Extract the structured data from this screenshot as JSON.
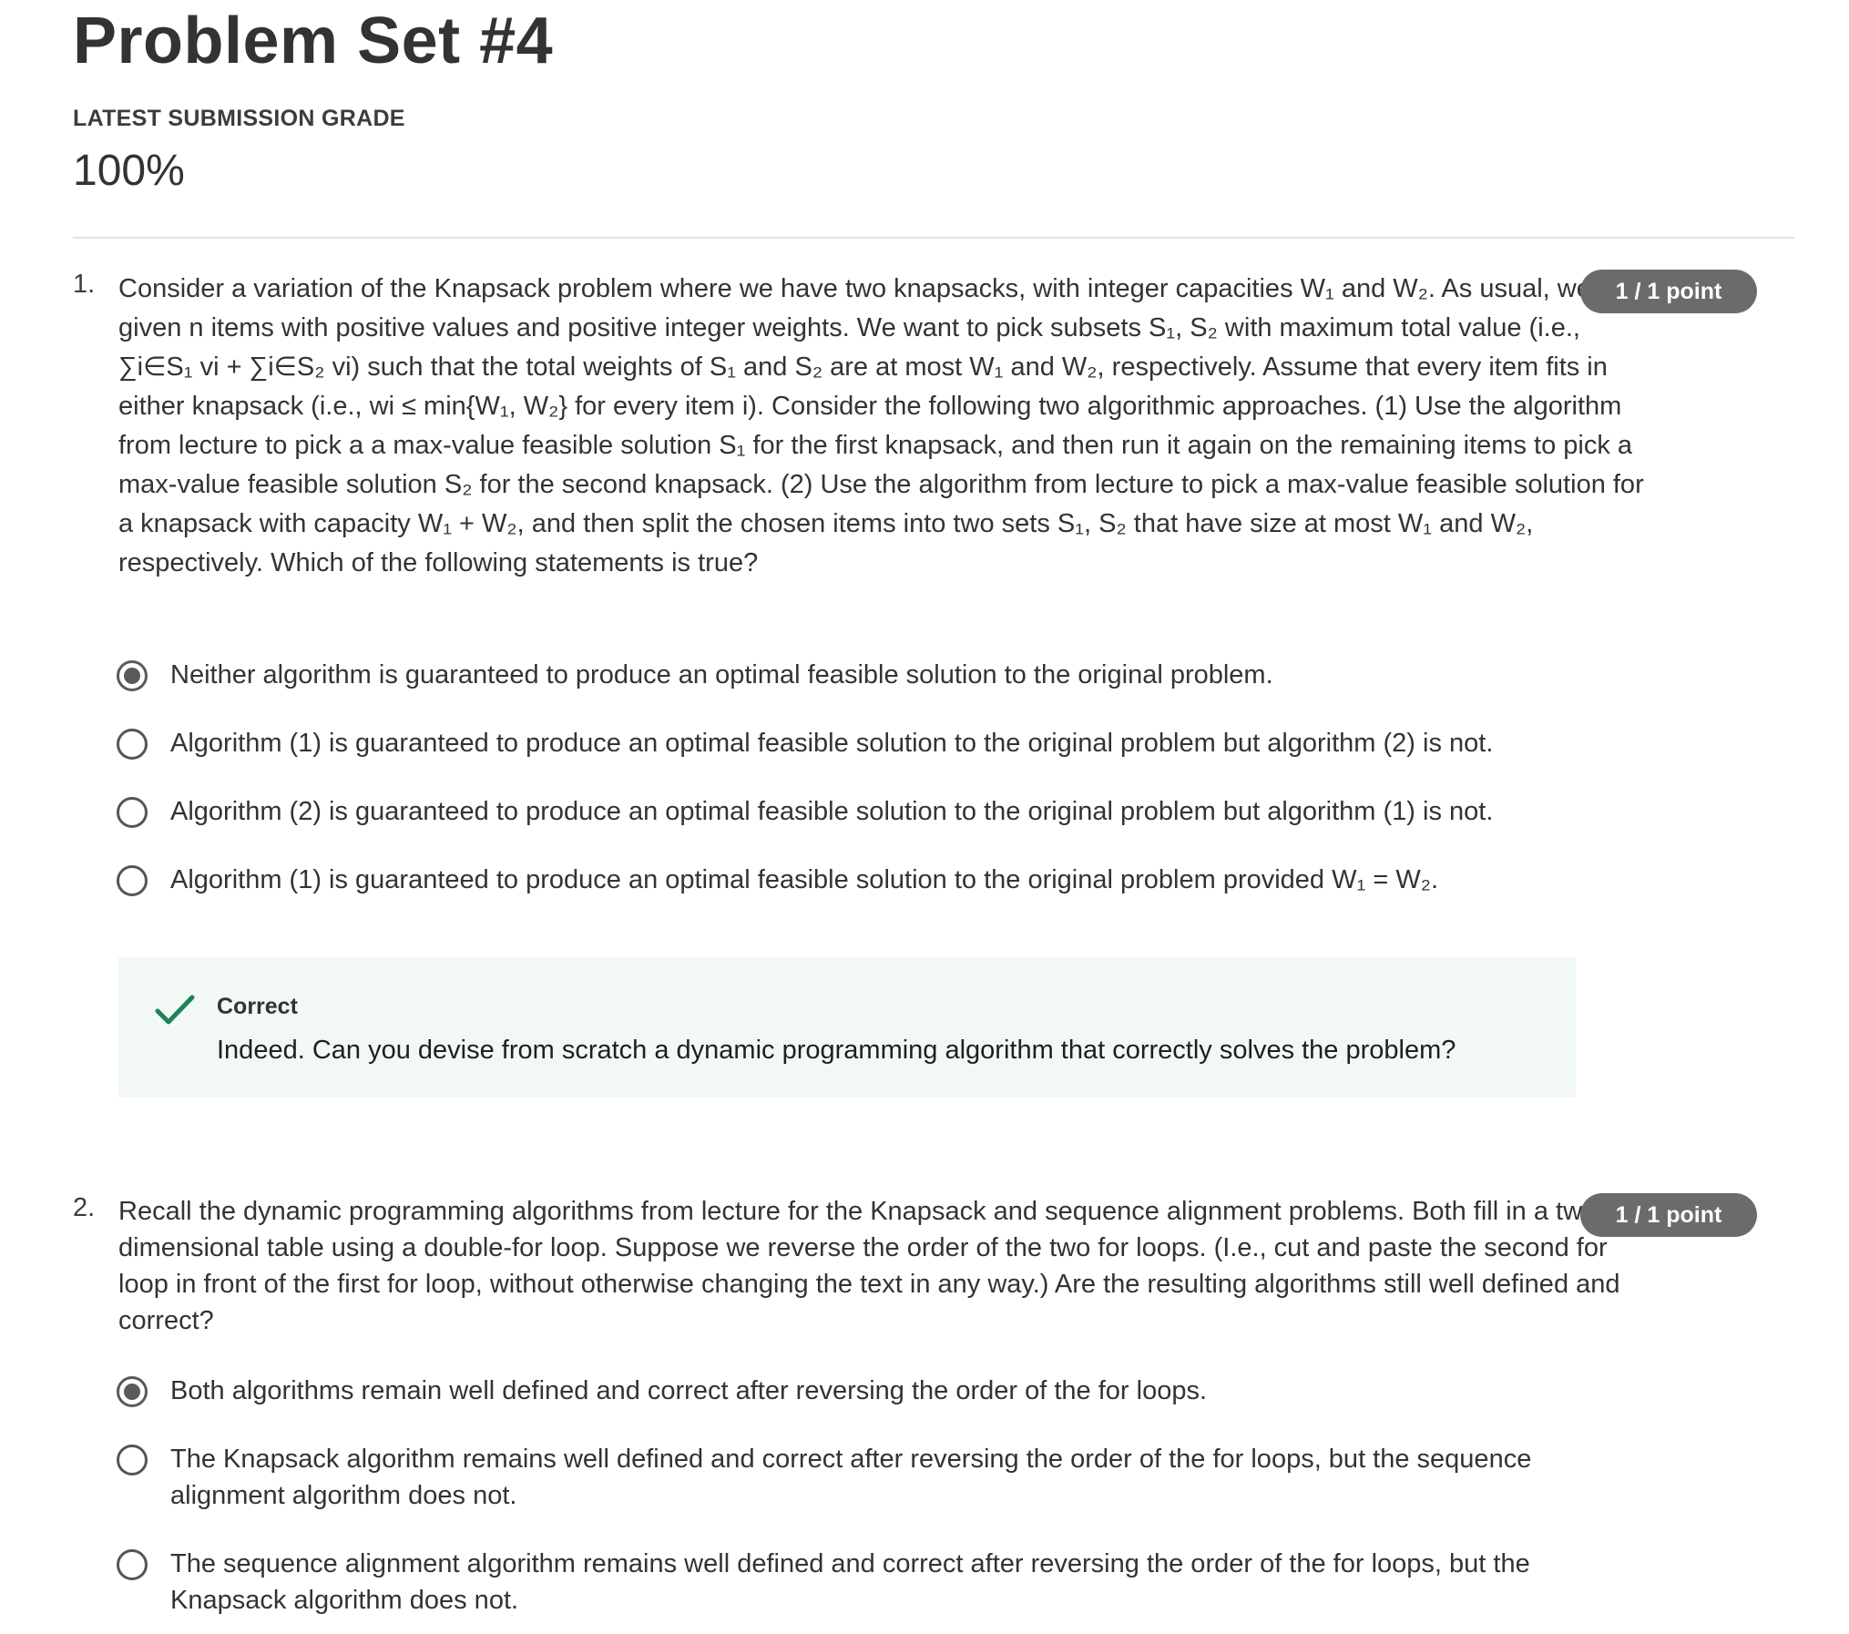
{
  "header": {
    "title": "Problem Set #4",
    "grade_label": "LATEST SUBMISSION GRADE",
    "grade_value": "100%"
  },
  "questions": [
    {
      "number": "1.",
      "points": "1 / 1 point",
      "text": "Consider a variation of the Knapsack problem where we have two knapsacks, with integer capacities W₁ and W₂. As usual, we are given n items with positive values and positive integer weights. We want to pick subsets S₁, S₂ with maximum total value (i.e., ∑i∈S₁ vi + ∑i∈S₂ vi) such that the total weights of S₁ and S₂ are at most W₁ and W₂, respectively. Assume that every item fits in either knapsack (i.e., wi ≤ min{W₁, W₂} for every item i). Consider the following two algorithmic approaches. (1) Use the algorithm from lecture to pick a a max-value feasible solution S₁ for the first knapsack, and then run it again on the remaining items to pick a max-value feasible solution S₂ for the second knapsack. (2) Use the algorithm from lecture to pick a max-value feasible solution for a knapsack with capacity W₁ + W₂, and then split the chosen items into two sets S₁, S₂ that have size at most W₁ and W₂, respectively. Which of the following statements is true?",
      "options": [
        {
          "label": "Neither algorithm is guaranteed to produce an optimal feasible solution to the original problem.",
          "selected": true
        },
        {
          "label": "Algorithm (1) is guaranteed to produce an optimal feasible solution to the original problem but algorithm (2) is not.",
          "selected": false
        },
        {
          "label": "Algorithm (2) is guaranteed to produce an optimal feasible solution to the original problem but algorithm (1) is not.",
          "selected": false
        },
        {
          "label": "Algorithm (1) is guaranteed to produce an optimal feasible solution to the original problem provided W₁ = W₂.",
          "selected": false
        }
      ],
      "feedback": {
        "title": "Correct",
        "text": "Indeed. Can you devise from scratch a dynamic programming algorithm that correctly solves the problem?",
        "icon": "checkmark-icon",
        "color": "#1f8354"
      }
    },
    {
      "number": "2.",
      "points": "1 / 1 point",
      "text": "Recall the dynamic programming algorithms from lecture for the Knapsack and sequence alignment problems. Both fill in a two-dimensional table using a double-for loop. Suppose we reverse the order of the two for loops. (I.e., cut and paste the second for loop in front of the first for loop, without otherwise changing the text in any way.) Are the resulting algorithms still well defined and correct?",
      "options": [
        {
          "label": "Both algorithms remain well defined and correct after reversing the order of the for loops.",
          "selected": true
        },
        {
          "label": "The Knapsack algorithm remains well defined and correct after reversing the order of the for loops, but the sequence alignment algorithm does not.",
          "selected": false
        },
        {
          "label": "The sequence alignment algorithm remains well defined and correct after reversing the order of the for loops, but the Knapsack algorithm does not.",
          "selected": false
        }
      ]
    }
  ],
  "colors": {
    "points_badge": "#6b6b6b",
    "feedback_bg": "#f2f8f5",
    "divider": "#e1e1e1"
  }
}
